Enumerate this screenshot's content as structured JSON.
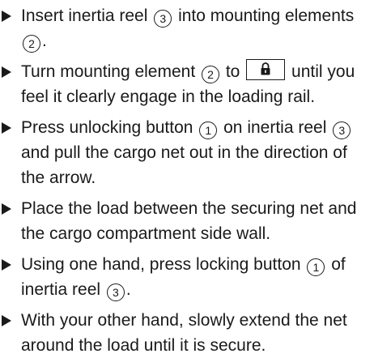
{
  "instructions": {
    "step1": {
      "t1": "Insert inertia reel ",
      "n1": "3",
      "t2": " into mounting elements ",
      "n2": "2",
      "t3": "."
    },
    "step2": {
      "t1": "Turn mounting element ",
      "n1": "2",
      "t2": " to ",
      "t3": " until you feel it clearly engage in the loading rail.",
      "icon": "lock-icon"
    },
    "step3": {
      "t1": "Press unlocking button ",
      "n1": "1",
      "t2": " on inertia reel ",
      "n2": "3",
      "t3": " and pull the cargo net out in the direction of the arrow."
    },
    "step4": {
      "t1": "Place the load between the securing net and the cargo compartment side wall."
    },
    "step5": {
      "t1": "Using one hand, press locking button ",
      "n1": "1",
      "t2": " of inertia reel ",
      "n2": "3",
      "t3": "."
    },
    "step6": {
      "t1": "With your other hand, slowly extend the net around the load until it is secure."
    }
  }
}
